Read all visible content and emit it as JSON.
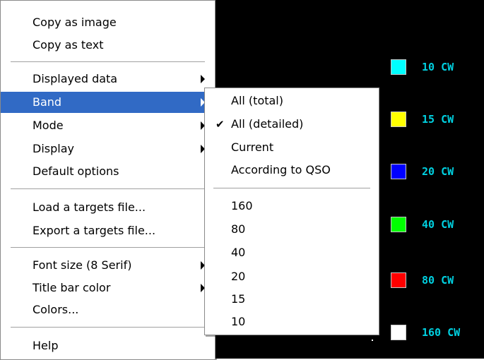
{
  "main_menu": {
    "copy_as_image": "Copy as image",
    "copy_as_text": "Copy as text",
    "displayed_data": "Displayed data",
    "band": "Band",
    "mode": "Mode",
    "display": "Display",
    "default_options": "Default options",
    "load_targets": "Load a targets file...",
    "export_targets": "Export a targets file...",
    "font_size": "Font size (8 Serif)",
    "title_bar_color": "Title bar color",
    "colors": "Colors...",
    "help": "Help"
  },
  "band_submenu": {
    "all_total": "All (total)",
    "all_detailed": "All (detailed)",
    "current": "Current",
    "according_to_qso": "According to QSO",
    "b160": "160",
    "b80": "80",
    "b40": "40",
    "b20": "20",
    "b15": "15",
    "b10": "10",
    "checked_item": "All (detailed)"
  },
  "legend": [
    {
      "label": "10 CW",
      "color": "#00ffff"
    },
    {
      "label": "15 CW",
      "color": "#ffff00"
    },
    {
      "label": "20 CW",
      "color": "#0000ff"
    },
    {
      "label": "40 CW",
      "color": "#00ff00"
    },
    {
      "label": "80 CW",
      "color": "#ff0000"
    },
    {
      "label": "160 CW",
      "color": "#ffffff"
    }
  ],
  "colors": {
    "selection": "#316ac5",
    "legend_text": "#00d0e0",
    "background": "#000000"
  }
}
